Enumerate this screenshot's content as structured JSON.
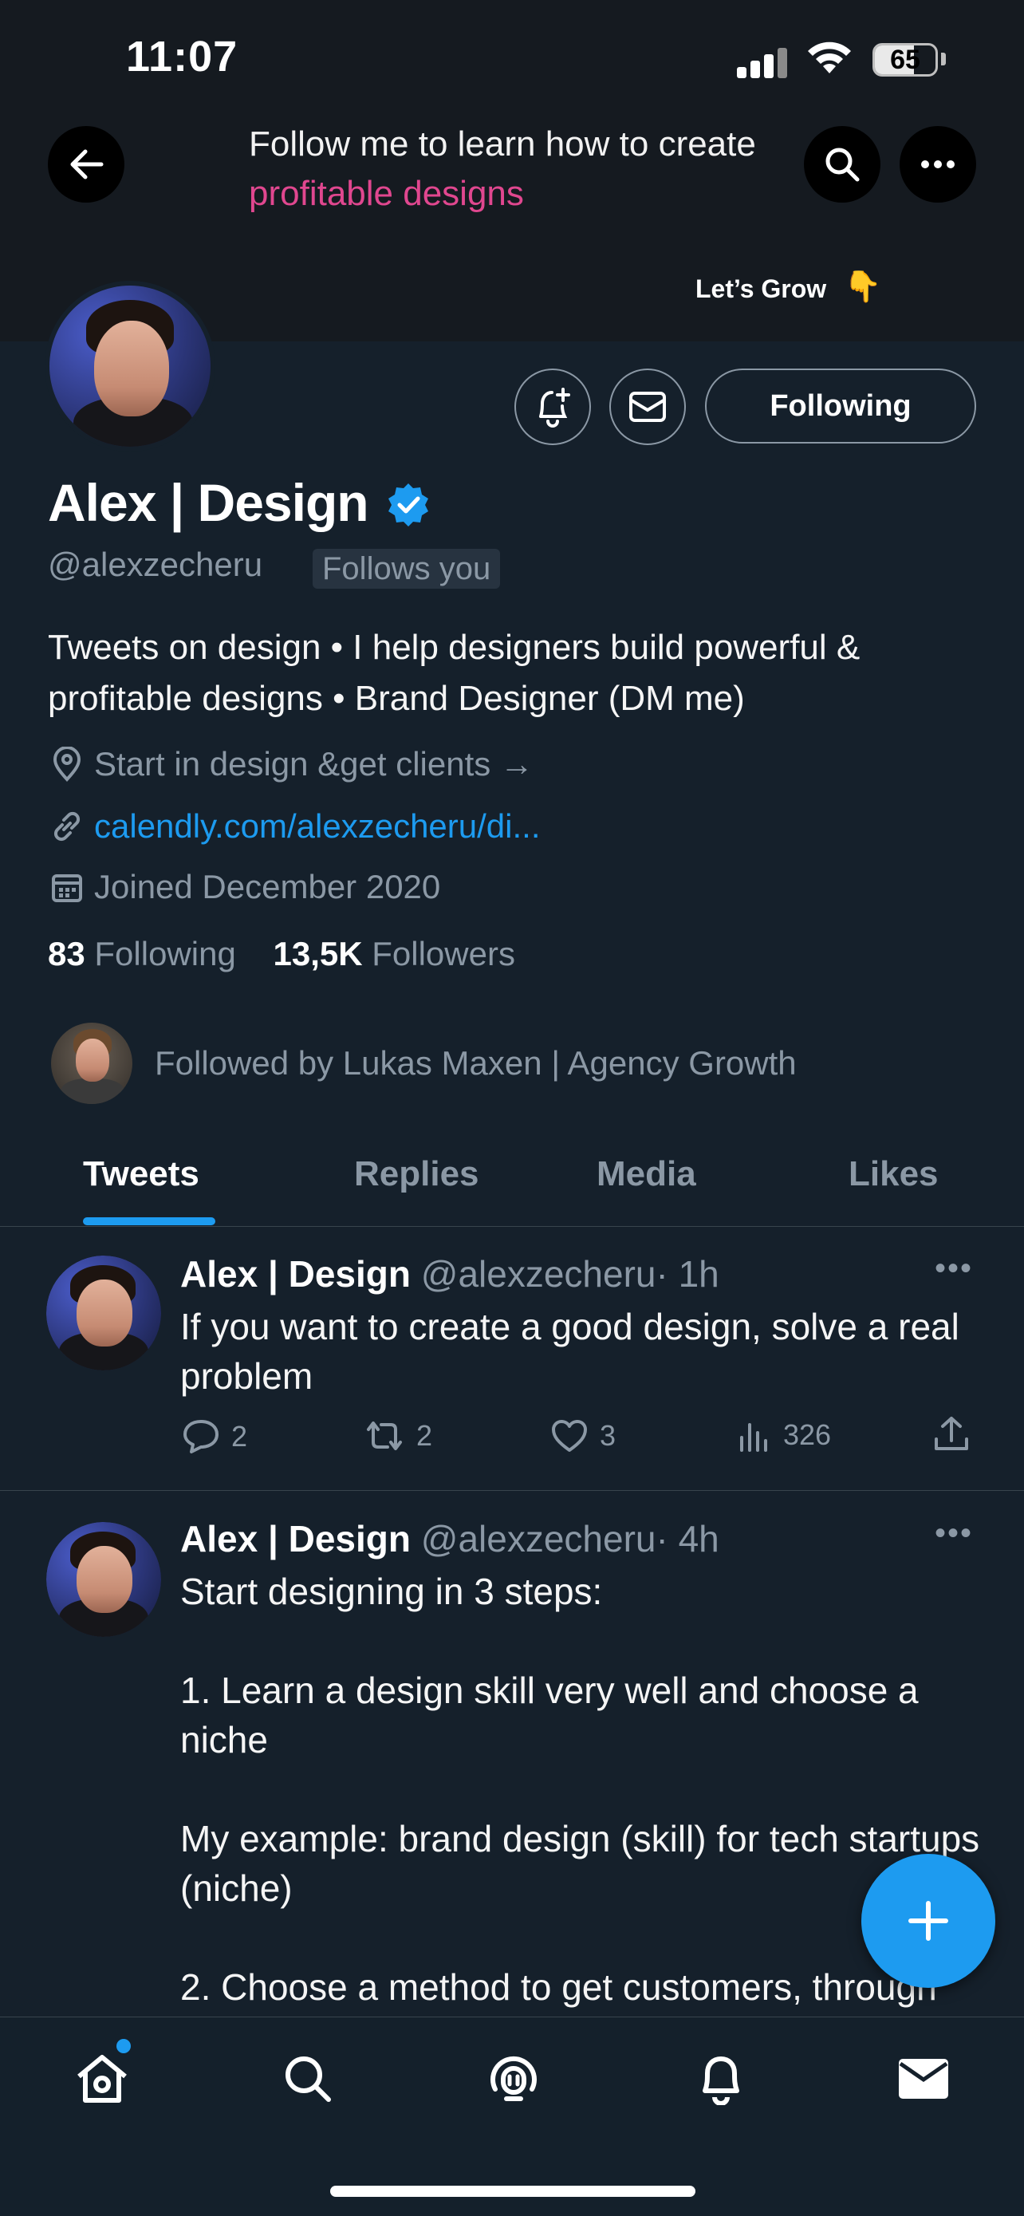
{
  "status_bar": {
    "time": "11:07",
    "battery": "65",
    "battery_level": 0.65
  },
  "banner": {
    "line1": "Follow me to learn how to create",
    "line2": "profitable designs",
    "cta": "Let’s Grow",
    "cta_emoji": "👇"
  },
  "profile": {
    "name": "Alex | Design",
    "handle": "@alexzecheru",
    "follows_you": "Follows you",
    "bio": "Tweets on design • I help designers build powerful & profitable designs • Brand Designer (DM me)",
    "location": "Start in design &get clients →",
    "link": "calendly.com/alexzecheru/di...",
    "joined": "Joined December 2020",
    "following_count": "83",
    "following_label": "Following",
    "followers_count": "13,5K",
    "followers_label": "Followers",
    "followed_by": "Followed by Lukas Maxen | Agency Growth",
    "follow_button": "Following"
  },
  "tabs": [
    "Tweets",
    "Replies",
    "Media",
    "Likes"
  ],
  "tweets": [
    {
      "name": "Alex | Design",
      "handle": "@alexzecheru",
      "time": "· 1h",
      "text": "If you want to create a good design, solve a real problem",
      "replies": "2",
      "retweets": "2",
      "likes": "3",
      "views": "326"
    },
    {
      "name": "Alex | Design",
      "handle": "@alexzecheru",
      "time": "· 4h",
      "text": "Start designing in 3 steps:\n\n1. Learn a design skill very well and choose a niche\n\nMy example: brand design (skill) for tech startups (niche)\n\n2. Choose a method to get customers, through"
    }
  ],
  "colors": {
    "accent": "#1d9bf0",
    "background": "#15202b",
    "muted": "#8b98a5",
    "banner_pink": "#e0478f"
  },
  "icons": {
    "nav": [
      "home-icon",
      "search-icon",
      "spaces-icon",
      "notifications-icon",
      "messages-icon"
    ]
  }
}
